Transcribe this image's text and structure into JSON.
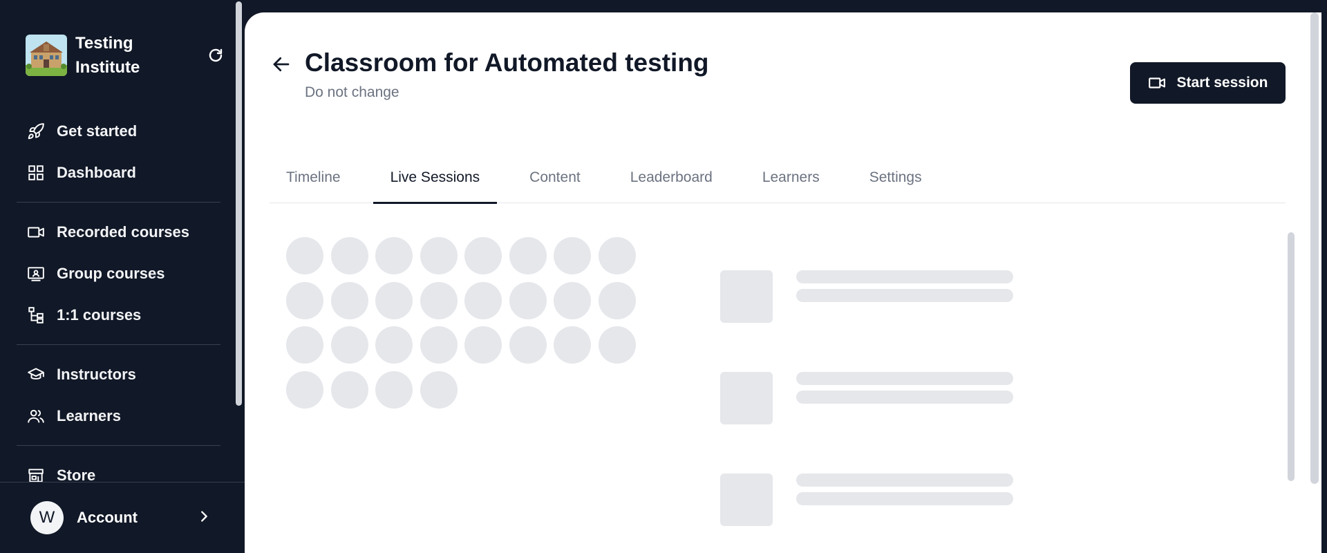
{
  "sidebar": {
    "brand_name": "Testing Institute",
    "logo_icon": "school-building-logo",
    "groups": [
      [
        {
          "label": "Get started",
          "icon": "rocket-icon"
        },
        {
          "label": "Dashboard",
          "icon": "grid-icon"
        }
      ],
      [
        {
          "label": "Recorded courses",
          "icon": "video-camera-icon"
        },
        {
          "label": "Group courses",
          "icon": "presentation-icon"
        },
        {
          "label": "1:1 courses",
          "icon": "hierarchy-icon"
        }
      ],
      [
        {
          "label": "Instructors",
          "icon": "graduation-cap-icon"
        },
        {
          "label": "Learners",
          "icon": "users-icon"
        }
      ],
      [
        {
          "label": "Store",
          "icon": "store-icon"
        }
      ]
    ],
    "account": {
      "avatar_initial": "W",
      "label": "Account"
    }
  },
  "header": {
    "title": "Classroom for Automated testing",
    "subtitle": "Do not change",
    "start_session_label": "Start session"
  },
  "tabs": [
    {
      "label": "Timeline",
      "active": false
    },
    {
      "label": "Live Sessions",
      "active": true
    },
    {
      "label": "Content",
      "active": false
    },
    {
      "label": "Leaderboard",
      "active": false
    },
    {
      "label": "Learners",
      "active": false
    },
    {
      "label": "Settings",
      "active": false
    }
  ],
  "colors": {
    "sidebar_bg": "#111827",
    "skeleton": "#e5e7eb",
    "primary_button": "#111827"
  }
}
